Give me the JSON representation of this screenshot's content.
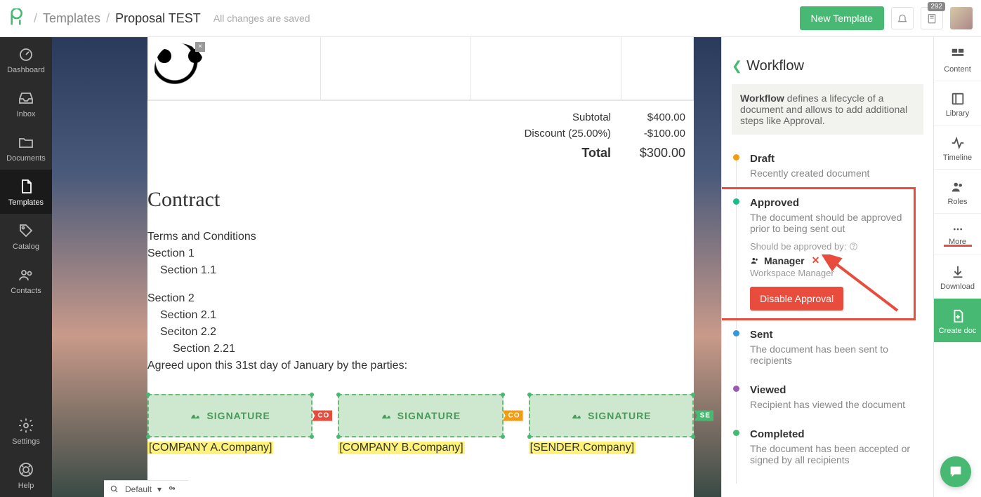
{
  "header": {
    "breadcrumb_parent": "Templates",
    "breadcrumb_current": "Proposal TEST",
    "saved_status": "All changes are saved",
    "new_template_label": "New Template",
    "notification_count": "292"
  },
  "left_nav": [
    {
      "label": "Dashboard",
      "icon": "gauge"
    },
    {
      "label": "Inbox",
      "icon": "inbox"
    },
    {
      "label": "Documents",
      "icon": "folder"
    },
    {
      "label": "Templates",
      "icon": "file",
      "active": true
    },
    {
      "label": "Catalog",
      "icon": "tag"
    },
    {
      "label": "Contacts",
      "icon": "users"
    }
  ],
  "left_nav_bottom": [
    {
      "label": "Settings",
      "icon": "gear"
    },
    {
      "label": "Help",
      "icon": "lifering"
    }
  ],
  "totals": {
    "subtotal_label": "Subtotal",
    "subtotal_value": "$400.00",
    "discount_label": "Discount (25.00%)",
    "discount_value": "-$100.00",
    "total_label": "Total",
    "total_value": "$300.00"
  },
  "contract": {
    "heading": "Contract",
    "terms_heading": "Terms and Conditions",
    "section1": "Section 1",
    "section1_1": "Section 1.1",
    "section2": "Section 2",
    "section2_1": "Section 2.1",
    "section2_2": "Seciton 2.2",
    "section2_21": "Section 2.21",
    "agreed": "Agreed upon this 31st day of January by the parties:"
  },
  "signatures": [
    {
      "label": "SIGNATURE",
      "tag": "CO",
      "tag_class": "co1",
      "company": "[COMPANY A.Company]"
    },
    {
      "label": "SIGNATURE",
      "tag": "CO",
      "tag_class": "co2",
      "company": "[COMPANY B.Company]"
    },
    {
      "label": "SIGNATURE",
      "tag": "SE",
      "tag_class": "se",
      "company": "[SENDER.Company]"
    }
  ],
  "workflow": {
    "title": "Workflow",
    "info_prefix": "Workflow",
    "info_rest": " defines a lifecycle of a document and allows to add additional steps like Approval.",
    "steps": [
      {
        "dot": "orange",
        "title": "Draft",
        "desc": "Recently created document"
      },
      {
        "dot": "green",
        "title": "Approved",
        "desc": "The document should be approved prior to being sent out",
        "approved": true
      },
      {
        "dot": "blue",
        "title": "Sent",
        "desc": "The document has been sent to recipients"
      },
      {
        "dot": "purple",
        "title": "Viewed",
        "desc": "Recipient has viewed the document"
      },
      {
        "dot": "green2",
        "title": "Completed",
        "desc": "The document has been accepted or signed by all recipients"
      }
    ],
    "approved_by_label": "Should be approved by:",
    "approver_name": "Manager",
    "approver_role": "Workspace Manager",
    "disable_label": "Disable Approval"
  },
  "tool_nav": [
    {
      "label": "Content",
      "icon": "blocks"
    },
    {
      "label": "Library",
      "icon": "book"
    },
    {
      "label": "Timeline",
      "icon": "pulse"
    },
    {
      "label": "Roles",
      "icon": "users"
    },
    {
      "label": "More",
      "icon": "dots"
    },
    {
      "label": "Download",
      "icon": "download"
    },
    {
      "label": "Create doc",
      "icon": "file-plus"
    }
  ],
  "bottom_bar": {
    "zoom_label": "Default"
  }
}
